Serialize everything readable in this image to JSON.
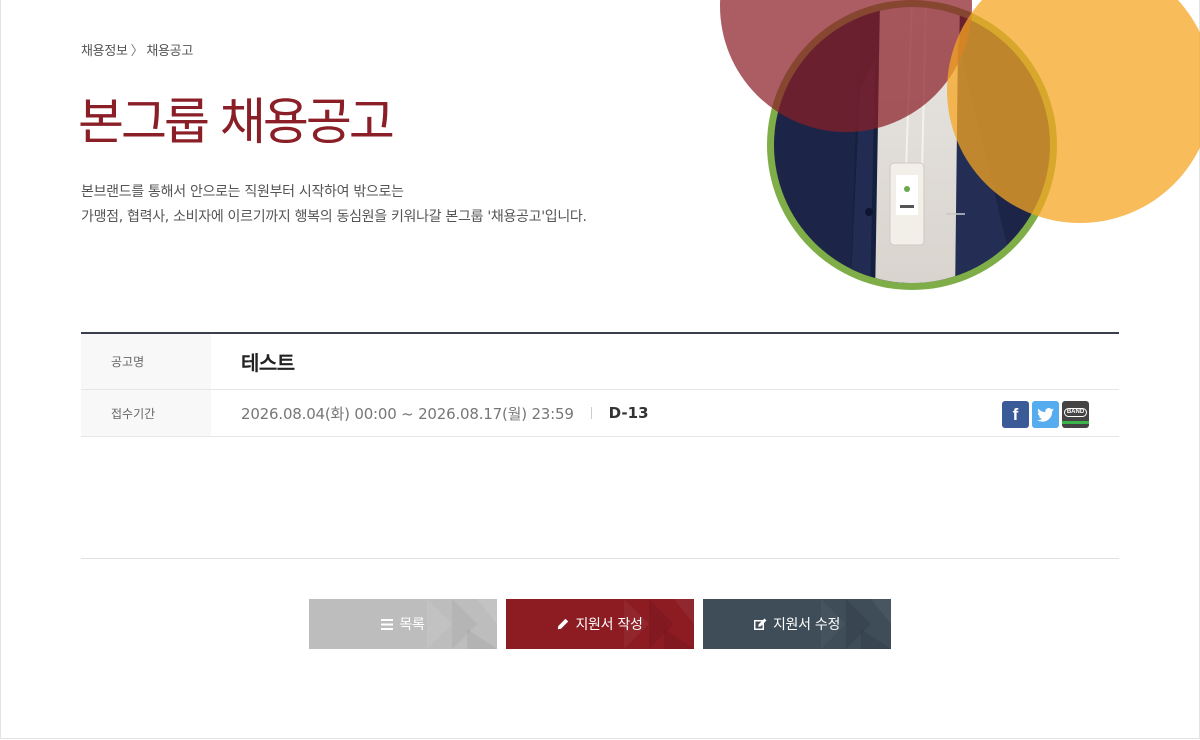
{
  "breadcrumb": {
    "parent": "채용정보",
    "separator": "〉",
    "current": "채용공고"
  },
  "page": {
    "title": "본그룹 채용공고",
    "description_line1": "본브랜드를 통해서 안으로는 직원부터 시작하여 밖으로는",
    "description_line2": "가맹점, 협력사, 소비자에 이르기까지 행복의 동심원을 키워나갈 본그룹 '채용공고'입니다."
  },
  "posting": {
    "name_label": "공고명",
    "name_value": "테스트",
    "period_label": "접수기간",
    "period_value": "2026.08.04(화) 00:00 ~ 2026.08.17(월) 23:59",
    "dday": "D-13"
  },
  "share": {
    "facebook_glyph": "f",
    "band_label": "BAND",
    "icons": [
      "facebook-icon",
      "twitter-icon",
      "band-icon"
    ]
  },
  "buttons": {
    "list_label": "목록",
    "apply_label": "지원서 작성",
    "edit_label": "지원서 수정"
  },
  "colors": {
    "brand_red": "#8a1f27",
    "button_gray": "#bdbdbd",
    "button_red": "#8c1b22",
    "button_slate": "#3e4d58",
    "circle_dark_red": "#9e3f45",
    "circle_orange": "#f5b547",
    "circle_ring_green": "#7fae48"
  }
}
